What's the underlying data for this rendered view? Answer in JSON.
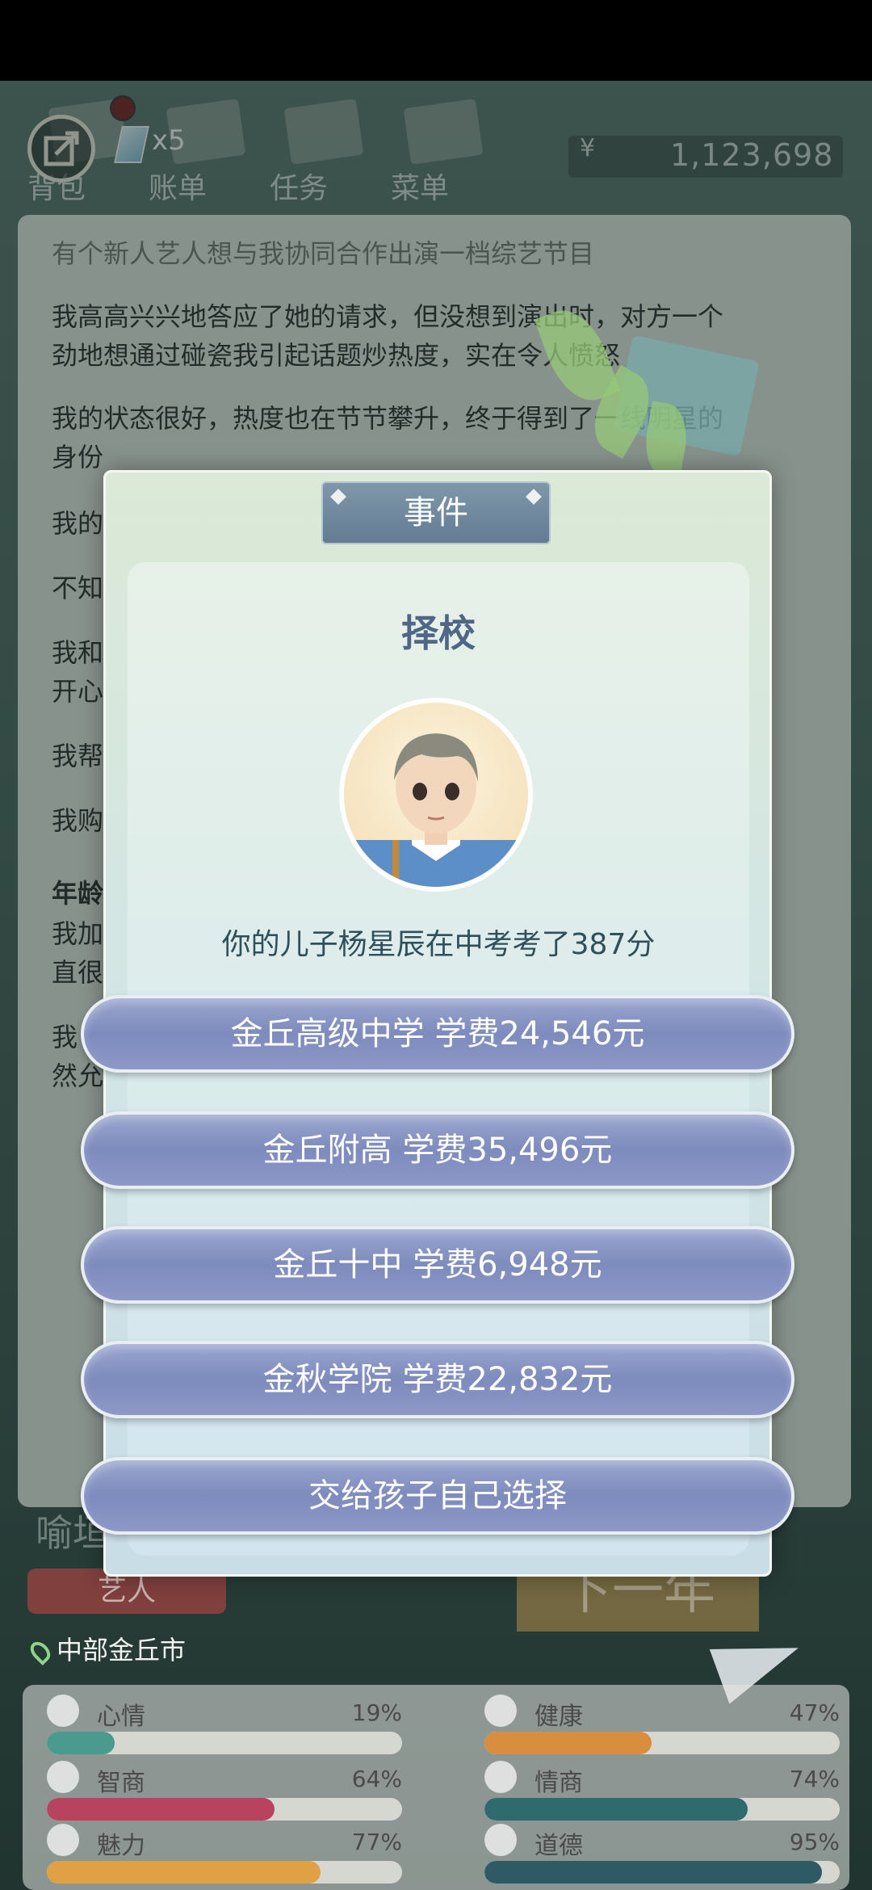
{
  "top_nav": {
    "ticket_count": "x5",
    "items": [
      {
        "label": "背包"
      },
      {
        "label": "账单"
      },
      {
        "label": "任务"
      },
      {
        "label": "菜单"
      }
    ],
    "money_symbol": "¥",
    "money": "1,123,698"
  },
  "story": {
    "lines": [
      "有个新人艺人想与我协同合作出演一档综艺节目",
      "我高高兴兴地答应了她的请求，但没想到演出时，对方一个",
      "劲地想通过碰瓷我引起话题炒热度，实在令人愤怒",
      "我的状态很好，热度也在节节攀升，终于得到了一线明星的",
      "身份",
      "我的",
      "不知",
      "我和",
      "开心",
      "我帮",
      "我购",
      "年龄",
      "我加",
      "直很",
      "我",
      "然允"
    ],
    "bold_line": "年龄"
  },
  "behind": {
    "name_fragment": "喻垣",
    "role_pill": "艺人",
    "next_year": "下一年"
  },
  "modal": {
    "tab_label": "事件",
    "title": "择校",
    "description": "你的儿子杨星辰在中考考了387分",
    "choices": [
      {
        "label": "金丘高级中学  学费24,546元"
      },
      {
        "label": "金丘附高  学费35,496元"
      },
      {
        "label": "金丘十中  学费6,948元"
      },
      {
        "label": "金秋学院  学费22,832元"
      },
      {
        "label": "交给孩子自己选择"
      }
    ]
  },
  "location": "中部金丘市",
  "stats": [
    {
      "label": "心情",
      "value": "19%",
      "fraction": 0.19,
      "color": "#4a9a90"
    },
    {
      "label": "健康",
      "value": "47%",
      "fraction": 0.47,
      "color": "#d98d3e"
    },
    {
      "label": "智商",
      "value": "64%",
      "fraction": 0.64,
      "color": "#b8435f"
    },
    {
      "label": "情商",
      "value": "74%",
      "fraction": 0.74,
      "color": "#2e6a6e"
    },
    {
      "label": "魅力",
      "value": "77%",
      "fraction": 0.77,
      "color": "#e0a044"
    },
    {
      "label": "道德",
      "value": "95%",
      "fraction": 0.95,
      "color": "#2e5a66"
    }
  ]
}
